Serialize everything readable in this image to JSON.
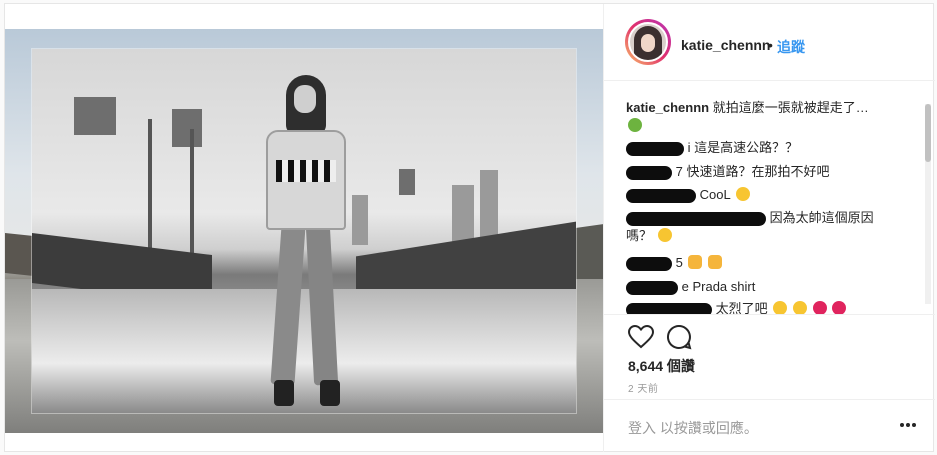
{
  "post": {
    "username": "katie_chennn",
    "dot": "•",
    "follow_label": "追蹤",
    "caption": "就拍這麼一張就被趕走了…"
  },
  "comments": [
    {
      "text": "i 這是高速公路？？"
    },
    {
      "text": "7 快速道路？在那拍不好吧"
    },
    {
      "text": "CooL"
    },
    {
      "text": "因為太帥這個原因"
    },
    {
      "text": "嗎？"
    },
    {
      "text": "5"
    },
    {
      "text": "e Prada shirt"
    },
    {
      "text": "太烈了吧"
    }
  ],
  "stats": {
    "views": "8,644 個讚",
    "time": "2 天前"
  },
  "footer": {
    "login_text": "登入 以按讚或回應。"
  },
  "colors": {
    "accent": "#3897f0",
    "text": "#262626",
    "muted": "#999999"
  },
  "icons": [
    "heart-icon",
    "comment-bubble-icon",
    "more-options-icon"
  ]
}
